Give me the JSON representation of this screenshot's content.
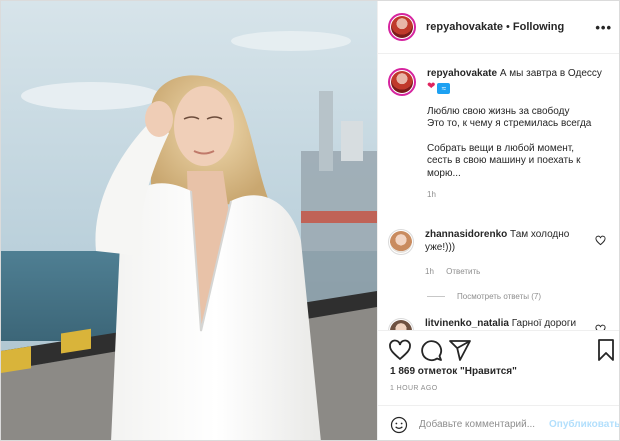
{
  "post": {
    "username": "repyahovakate",
    "follow_separator": "•",
    "follow_status": "Following",
    "more_icon": "more-horizontal-icon",
    "caption": {
      "username": "repyahovakate",
      "first_line": "А мы завтра в Одессу",
      "emoji": [
        "red-heart",
        "water-wave"
      ],
      "paragraph_1": [
        "Люблю свою жизнь за свободу",
        "Это то, к чему я стремилась всегда"
      ],
      "paragraph_2": [
        "Собрать вещи в любой момент,",
        "сесть в свою машину и поехать к",
        "морю..."
      ],
      "time": "1h"
    },
    "comments": [
      {
        "username": "zhannasidorenko",
        "text": "Там холодно уже!)))",
        "time": "1h",
        "reply_label": "Ответить",
        "view_replies": "Посмотреть ответы (7)"
      },
      {
        "username": "litvinenko_natalia",
        "text": "Гарної дороги"
      }
    ],
    "likes": "1 869 отметок \"Нравится\"",
    "posted_ago": "1 HOUR AGO",
    "add_comment": {
      "placeholder": "Добавьте комментарий...",
      "post_label": "Опубликовать"
    },
    "colors": {
      "story_ring": "#d6249f",
      "like_heart": "#e0245e",
      "publish_disabled": "#b2dffc",
      "muted_text": "#8e8e8e"
    }
  }
}
